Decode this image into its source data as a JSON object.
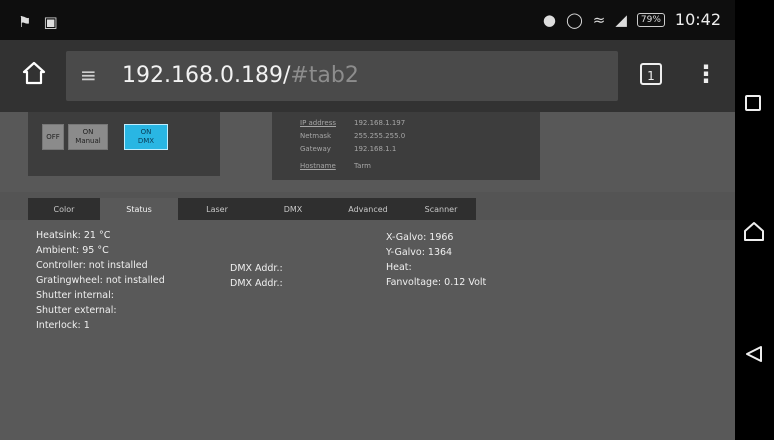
{
  "statusbar": {
    "left_icons": [
      "notification-icon",
      "image-icon"
    ],
    "right_icons": [
      "record-icon",
      "alarm-icon",
      "wifi-icon",
      "signal-icon"
    ],
    "battery": "79%",
    "time": "10:42"
  },
  "browser": {
    "url_host": "192.168.0.189/",
    "url_hash": "#tab2",
    "tab_count": "1"
  },
  "mode_buttons": {
    "off": "OFF",
    "on_manual": "ON\nManual",
    "on_dmx": "ON\nDMX"
  },
  "network": {
    "rows": [
      {
        "key": "IP address",
        "value": "192.168.1.197"
      },
      {
        "key": "Netmask",
        "value": "255.255.255.0"
      },
      {
        "key": "Gateway",
        "value": "192.168.1.1"
      },
      {
        "key": "Hostname",
        "value": "Tarm"
      }
    ]
  },
  "tabs": [
    "Color",
    "Status",
    "Laser",
    "DMX",
    "Advanced",
    "Scanner"
  ],
  "active_tab": "Status",
  "status": {
    "heatsink": "Heatsink: 21 °C",
    "ambient": "Ambient: 95 °C",
    "controller": "Controller: not installed",
    "gratingwheel": "Gratingwheel: not installed",
    "shutter_internal": "Shutter internal:",
    "shutter_external": "Shutter external:",
    "interlock": "Interlock: 1",
    "dmx_addr_1": "DMX Addr.:",
    "dmx_addr_2": "DMX Addr.:",
    "x_galvo": "X-Galvo: 1966",
    "y_galvo": "Y-Galvo: 1364",
    "heat": "Heat:",
    "fanvoltage": "Fanvoltage: 0.12 Volt"
  },
  "colors": {
    "accent": "#29b6e3",
    "page_bg": "#595959",
    "toolbar_bg": "#323232"
  }
}
